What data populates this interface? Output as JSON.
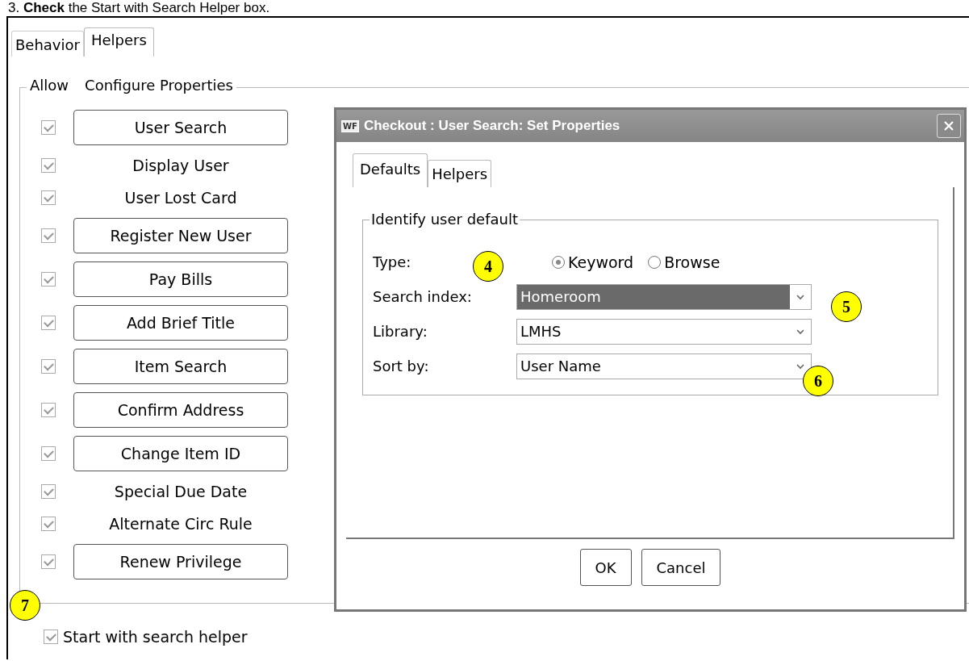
{
  "instruction": "3. **Check** the Start with Search Helper box.",
  "tabs": [
    {
      "label": "Behavior",
      "selected": false
    },
    {
      "label": "Helpers",
      "selected": true
    }
  ],
  "group": {
    "title_allow": "Allow",
    "title_configure": "Configure Properties"
  },
  "helpers": [
    {
      "label": "User Search",
      "kind": "button",
      "checked": true
    },
    {
      "label": "Display User",
      "kind": "label",
      "checked": true
    },
    {
      "label": "User Lost Card",
      "kind": "label",
      "checked": true
    },
    {
      "label": "Register New User",
      "kind": "button",
      "checked": true
    },
    {
      "label": "Pay Bills",
      "kind": "button",
      "checked": true
    },
    {
      "label": "Add Brief Title",
      "kind": "button",
      "checked": true
    },
    {
      "label": "Item Search",
      "kind": "button",
      "checked": true
    },
    {
      "label": "Confirm Address",
      "kind": "button",
      "checked": true
    },
    {
      "label": "Change Item ID",
      "kind": "button",
      "checked": true
    },
    {
      "label": "Special Due Date",
      "kind": "label",
      "checked": true
    },
    {
      "label": "Alternate Circ Rule",
      "kind": "label",
      "checked": true
    },
    {
      "label": "Renew Privilege",
      "kind": "button",
      "checked": true
    }
  ],
  "start_with_search_helper": {
    "label": "Start with search helper",
    "checked": true
  },
  "dialog": {
    "icon_text": "WF",
    "title": "Checkout : User Search: Set Properties",
    "tabs": [
      {
        "label": "Defaults",
        "selected": true
      },
      {
        "label": "Helpers",
        "selected": false
      }
    ],
    "group_title": "Identify user default",
    "type": {
      "label": "Type:",
      "options": [
        {
          "label": "Keyword",
          "selected": true
        },
        {
          "label": "Browse",
          "selected": false
        }
      ]
    },
    "fields": [
      {
        "label": "Search index:",
        "value": "Homeroom",
        "highlighted": true
      },
      {
        "label": "Library:",
        "value": "LMHS",
        "highlighted": false
      },
      {
        "label": "Sort by:",
        "value": "User Name",
        "highlighted": false
      }
    ],
    "buttons": [
      "OK",
      "Cancel"
    ]
  },
  "callouts": [
    "4",
    "5",
    "6",
    "7"
  ]
}
